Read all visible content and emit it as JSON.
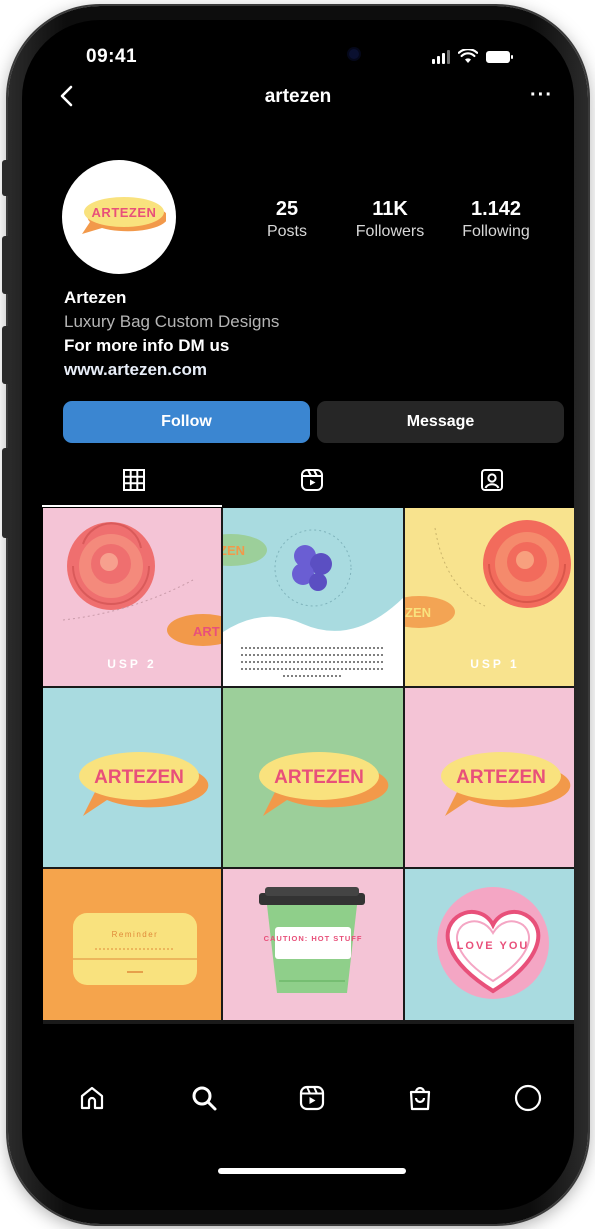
{
  "status_bar": {
    "time": "09:41"
  },
  "header": {
    "username": "artezen",
    "more_label": "···"
  },
  "profile": {
    "logo_text": "ARTEZEN",
    "stats": [
      {
        "value": "25",
        "label": "Posts"
      },
      {
        "value": "11K",
        "label": "Followers"
      },
      {
        "value": "1.142",
        "label": "Following"
      }
    ],
    "name": "Artezen",
    "category": "Luxury Bag Custom Designs",
    "bio": "For more info DM us",
    "website": "www.artezen.com"
  },
  "actions": {
    "follow_label": "Follow",
    "message_label": "Message"
  },
  "tabs": [
    {
      "icon": "grid-icon",
      "active": true
    },
    {
      "icon": "reels-icon",
      "active": false
    },
    {
      "icon": "tagged-icon",
      "active": false
    }
  ],
  "posts": [
    {
      "kind": "rose",
      "bg": "#f4c4d6",
      "caption": "USP 2",
      "logo_text": "ART"
    },
    {
      "kind": "wave",
      "bg": "#a9dbe0",
      "logo_text": "ZEN"
    },
    {
      "kind": "rose",
      "bg": "#f8e38e",
      "caption": "USP 1",
      "logo_text": "ZEN"
    },
    {
      "kind": "logo",
      "bg": "#a9dbe0",
      "logo_text": "ARTEZEN"
    },
    {
      "kind": "logo",
      "bg": "#9ccf9a",
      "logo_text": "ARTEZEN"
    },
    {
      "kind": "logo",
      "bg": "#f4c4d6",
      "logo_text": "ARTEZEN"
    },
    {
      "kind": "reminder",
      "bg": "#f5a44c",
      "caption": "Reminder"
    },
    {
      "kind": "cup",
      "bg": "#f4c4d6",
      "caption": "CAUTION: HOT STUFF"
    },
    {
      "kind": "heart",
      "bg": "#a9dbe0",
      "caption": "LOVE YOU"
    }
  ],
  "bottom_nav": [
    {
      "icon": "home-icon"
    },
    {
      "icon": "search-icon"
    },
    {
      "icon": "reels-nav-icon"
    },
    {
      "icon": "shop-icon"
    },
    {
      "icon": "profile-icon"
    }
  ],
  "colors": {
    "follow": "#3b86d1",
    "message": "#262626",
    "logo_orange": "#f2994a",
    "logo_yellow": "#f9e27e",
    "logo_pink": "#e8507a"
  }
}
